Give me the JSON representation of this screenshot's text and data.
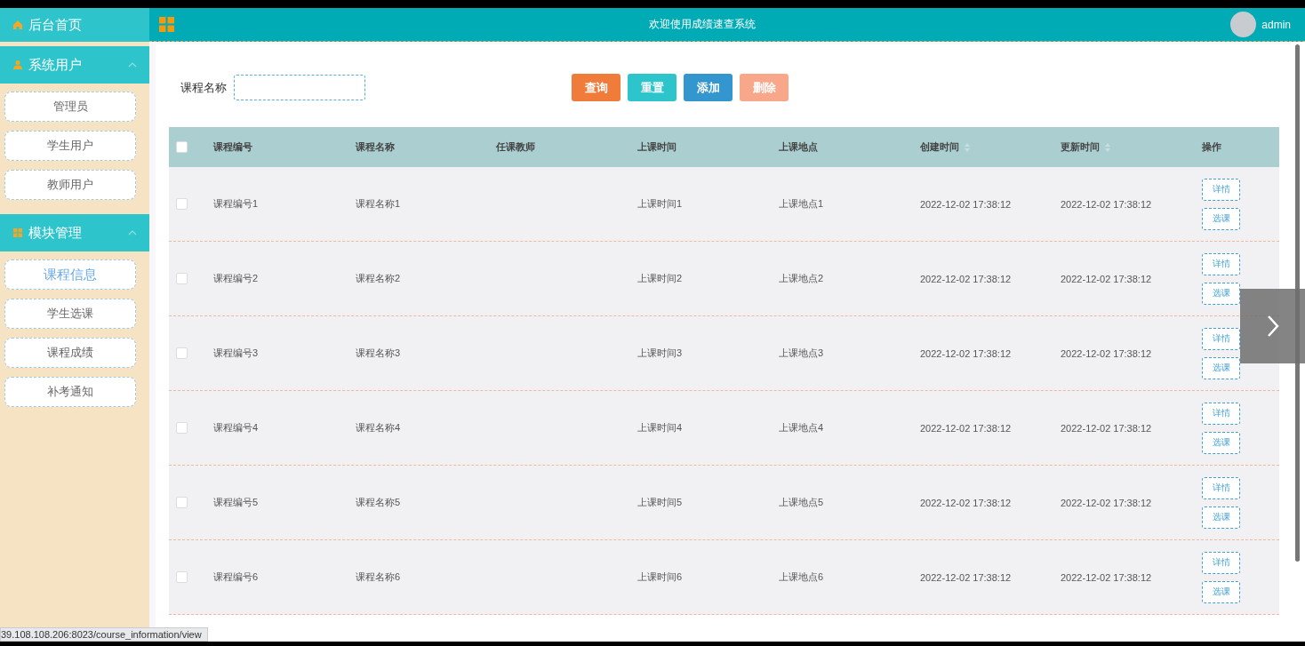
{
  "sidebar": {
    "home": {
      "label": "后台首页"
    },
    "groups": [
      {
        "label": "系统用户",
        "expanded": true,
        "items": [
          {
            "label": "管理员",
            "selected": false
          },
          {
            "label": "学生用户",
            "selected": false
          },
          {
            "label": "教师用户",
            "selected": false
          }
        ]
      },
      {
        "label": "模块管理",
        "expanded": true,
        "items": [
          {
            "label": "课程信息",
            "selected": true
          },
          {
            "label": "学生选课",
            "selected": false
          },
          {
            "label": "课程成绩",
            "selected": false
          },
          {
            "label": "补考通知",
            "selected": false
          }
        ]
      }
    ]
  },
  "header": {
    "title": "欢迎使用成绩速查系统",
    "user": "admin"
  },
  "search": {
    "label": "课程名称"
  },
  "buttons": [
    {
      "label": "查询",
      "kind": "query"
    },
    {
      "label": "重置",
      "kind": "reset"
    },
    {
      "label": "添加",
      "kind": "add"
    },
    {
      "label": "删除",
      "kind": "delete"
    }
  ],
  "table": {
    "select_all": false,
    "columns": [
      {
        "label": "课程编号",
        "sortable": false
      },
      {
        "label": "课程名称",
        "sortable": false
      },
      {
        "label": "任课教师",
        "sortable": false
      },
      {
        "label": "上课时间",
        "sortable": false
      },
      {
        "label": "上课地点",
        "sortable": false
      },
      {
        "label": "创建时间",
        "sortable": true
      },
      {
        "label": "更新时间",
        "sortable": true
      },
      {
        "label": "操作",
        "sortable": false
      }
    ],
    "rows": [
      {
        "checked": false,
        "cells": [
          "课程编号1",
          "课程名称1",
          "",
          "上课时间1",
          "上课地点1",
          "2022-12-02 17:38:12",
          "2022-12-02 17:38:12"
        ],
        "actions": [
          "详情",
          "选课"
        ]
      },
      {
        "checked": false,
        "cells": [
          "课程编号2",
          "课程名称2",
          "",
          "上课时间2",
          "上课地点2",
          "2022-12-02 17:38:12",
          "2022-12-02 17:38:12"
        ],
        "actions": [
          "详情",
          "选课"
        ]
      },
      {
        "checked": false,
        "cells": [
          "课程编号3",
          "课程名称3",
          "",
          "上课时间3",
          "上课地点3",
          "2022-12-02 17:38:12",
          "2022-12-02 17:38:12"
        ],
        "actions": [
          "详情",
          "选课"
        ]
      },
      {
        "checked": false,
        "cells": [
          "课程编号4",
          "课程名称4",
          "",
          "上课时间4",
          "上课地点4",
          "2022-12-02 17:38:12",
          "2022-12-02 17:38:12"
        ],
        "actions": [
          "详情",
          "选课"
        ]
      },
      {
        "checked": false,
        "cells": [
          "课程编号5",
          "课程名称5",
          "",
          "上课时间5",
          "上课地点5",
          "2022-12-02 17:38:12",
          "2022-12-02 17:38:12"
        ],
        "actions": [
          "详情",
          "选课"
        ]
      },
      {
        "checked": false,
        "cells": [
          "课程编号6",
          "课程名称6",
          "",
          "上课时间6",
          "上课地点6",
          "2022-12-02 17:38:12",
          "2022-12-02 17:38:12"
        ],
        "actions": [
          "详情",
          "选课"
        ]
      }
    ]
  },
  "status_url": "39.108.108.206:8023/course_information/view"
}
